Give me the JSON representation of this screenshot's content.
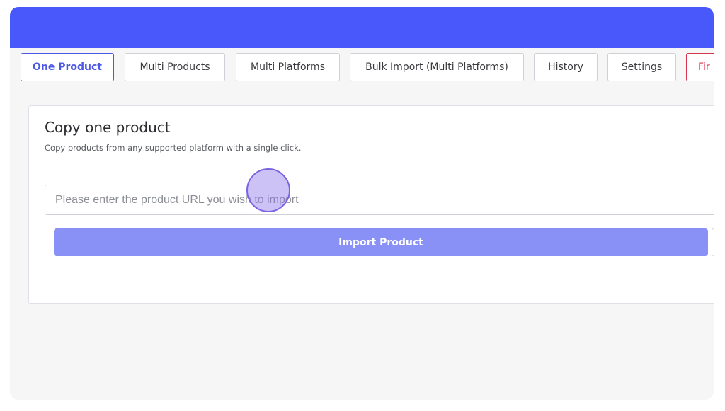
{
  "colors": {
    "topbar": "#4858fb",
    "accent": "#4c58e8",
    "danger": "#d8344d",
    "import_button": "#8990f6"
  },
  "tabs": [
    {
      "label": "One Product",
      "active": true
    },
    {
      "label": "Multi Products"
    },
    {
      "label": "Multi Platforms"
    },
    {
      "label": "Bulk Import (Multi Platforms)"
    },
    {
      "label": "History"
    },
    {
      "label": "Settings"
    },
    {
      "label": "Fir",
      "style": "danger"
    }
  ],
  "card": {
    "title": "Copy one product",
    "subtitle": "Copy products from any supported platform with a single click."
  },
  "url_input": {
    "placeholder": "Please enter the product URL you wish to import",
    "value": ""
  },
  "import_button": {
    "label": "Import Product"
  }
}
